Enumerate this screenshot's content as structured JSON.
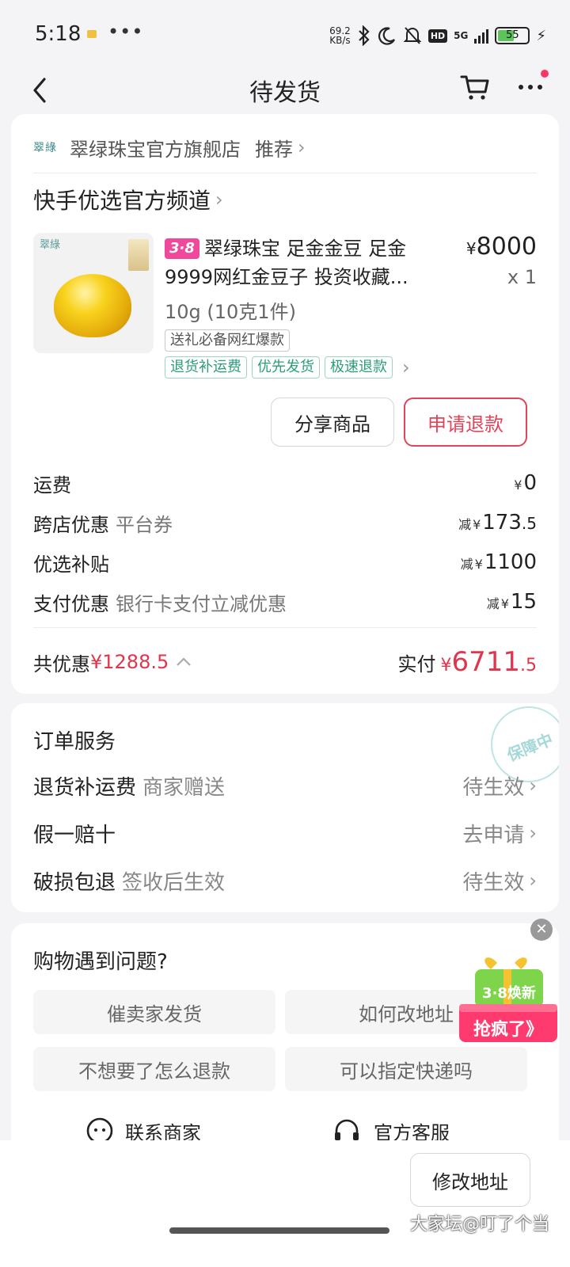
{
  "status_bar": {
    "time": "5:18",
    "net_speed_value": "69.2",
    "net_speed_unit": "KB/s",
    "network": "5G",
    "battery": "55"
  },
  "nav": {
    "title": "待发货"
  },
  "shop": {
    "logo_text": "翠綠",
    "name": "翠绿珠宝官方旗舰店",
    "recommend": "推荐"
  },
  "channel": {
    "label": "快手优选官方频道"
  },
  "product": {
    "image_logo": "翠綠",
    "badge": "3·8",
    "title": "翠绿珠宝 足金金豆 足金9999网红金豆子 投资收藏...",
    "price_symbol": "¥",
    "price": "8000",
    "quantity": "x 1",
    "spec": "10g (10克1件)",
    "promo_tag": "送礼必备网红爆款",
    "service_tags": [
      "退货补运费",
      "优先发货",
      "极速退款"
    ]
  },
  "actions": {
    "share": "分享商品",
    "refund": "申请退款"
  },
  "fees": [
    {
      "label": "运费",
      "sub": "",
      "prefix": "",
      "symbol": "¥",
      "int": "0",
      "dec": ""
    },
    {
      "label": "跨店优惠",
      "sub": "平台券",
      "prefix": "减",
      "symbol": "¥",
      "int": "173",
      "dec": ".5"
    },
    {
      "label": "优选补贴",
      "sub": "",
      "prefix": "减",
      "symbol": "¥",
      "int": "1100",
      "dec": ""
    },
    {
      "label": "支付优惠",
      "sub": "银行卡支付立减优惠",
      "prefix": "减",
      "symbol": "¥",
      "int": "15",
      "dec": ""
    }
  ],
  "totals": {
    "discount_label": "共优惠",
    "discount_value": "¥1288.5",
    "paid_label": "实付",
    "paid_symbol": "¥",
    "paid_int": "6711",
    "paid_dec": ".5"
  },
  "order_service": {
    "title": "订单服务",
    "stamp": "保障中",
    "rows": [
      {
        "label": "退货补运费",
        "sub": "商家赠送",
        "status": "待生效"
      },
      {
        "label": "假一赔十",
        "sub": "",
        "status": "去申请"
      },
      {
        "label": "破损包退",
        "sub": "签收后生效",
        "status": "待生效"
      }
    ]
  },
  "help": {
    "title": "购物遇到问题?",
    "buttons": [
      "催卖家发货",
      "如何改地址",
      "不想要了怎么退款",
      "可以指定快递吗"
    ],
    "contact_seller": "联系商家",
    "official_service": "官方客服"
  },
  "promo": {
    "top": "3·8焕新",
    "bottom": "抢疯了》"
  },
  "bottom": {
    "modify_address": "修改地址",
    "watermark": "大家坛@叮了个当"
  },
  "colors": {
    "accent_red": "#e0364d",
    "green_tag": "#2a9d7a",
    "badge_pink": "#f0489a"
  }
}
